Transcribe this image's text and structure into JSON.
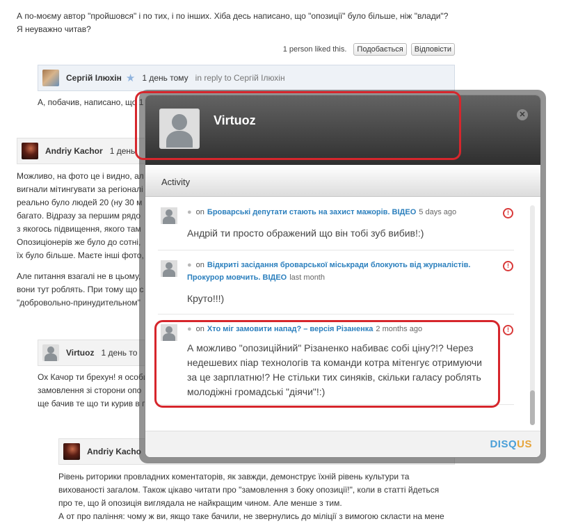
{
  "thread": {
    "para1_line1": "А по-моєму автор \"пройшовся\" і по тих, і по інших. Хіба десь написано, що \"опозиції\" було більше, ніж \"влади\"?",
    "para1_line2": "Я неуважно читав?",
    "liked_text": "1 person liked this.",
    "like_button": "Подобається",
    "reply_button": "Відповісти",
    "comment1": {
      "author": "Сергій Ілюхін",
      "time": "1 день тому",
      "reply_to": "in reply to Сергій Ілюхін",
      "text": "А, побачив, написано, що 1"
    },
    "comment2": {
      "author": "Andriy Kachor",
      "time": "1 день",
      "lines": [
        "Можливо, на фото це і видно, ал",
        "вигнали мітингувати за регіоналі",
        "реально було людей 20 (ну 30 м",
        "багато. Відразу за першим рядо",
        "з якогось підвищення, якого там",
        "Опозиціонерів же було до сотні,",
        "їх було більше. Маєте інші фото,"
      ],
      "lines2": [
        "Але питання взагалі не в цьому,",
        "вони тут роблять.  При тому що с",
        "\"добровольно-принудительном\""
      ]
    },
    "comment3": {
      "author": "Virtuoz",
      "time": "1 день то",
      "lines": [
        "Ох Качор ти брехун! я особи",
        "замовлення зі сторони опо",
        "ще бачив те що ти курив в гр"
      ]
    },
    "comment4": {
      "author": "Andriy Kacho",
      "lines": [
        "Рівень риторики провладних коментаторів, як завжди, демонструє їхній рівень культури та",
        "вихованості загалом. Також цікаво читати про \"замовлення з боку опозиції!\", коли в статті йдеться",
        "про те, що й опозиція виглядала не найкращим чином. Але менше з тим.",
        "А от про паління: чому ж ви, якщо таке бачили, не звернулись до міліції з вимогою скласти на мене"
      ]
    }
  },
  "modal": {
    "username": "Virtuoz",
    "tab": "Activity",
    "brand": {
      "part1": "DISQ",
      "part2": "US"
    },
    "items": [
      {
        "on": "on",
        "link": "Броварські депутати стають на захист мажорів. ВІДЕО",
        "time": "5 days ago",
        "body": "Андрій ти просто ображений що він тобі зуб вибив!:)"
      },
      {
        "on": "on",
        "link": "Відкриті засідання броварської міськради блокують від журналістів. Прокурор мовчить. ВІДЕО",
        "time": "last month",
        "body": "Круто!!!)"
      },
      {
        "on": "on",
        "link": "Хто міг замовити напад? – версія Різаненка",
        "time": "2 months ago",
        "body_lines": [
          "А можливо \"опозиційний\" Різаненко набиває собі ціну?!? Через",
          "недешевих піар технологів та команди котра мітенгує отримуючи",
          "за це зарплатню!? Не стільки тих синяків, скільки  галасу роблять",
          "молодіжні громадські \"діячи\"!:)"
        ]
      }
    ]
  },
  "colors": {
    "accent_red": "#d6262c",
    "link_blue": "#2b7fbd",
    "header_dark": "#2f2f2f"
  }
}
